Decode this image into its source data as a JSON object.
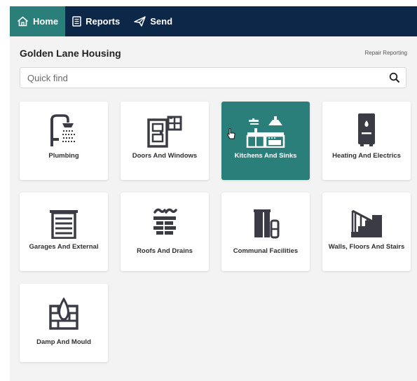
{
  "nav": {
    "home_label": "Home",
    "reports_label": "Reports",
    "send_label": "Send"
  },
  "header": {
    "title": "Golden Lane Housing",
    "subtitle": "Repair Reporting"
  },
  "search": {
    "placeholder": "Quick find",
    "value": ""
  },
  "tiles": [
    {
      "label": "Plumbing",
      "icon": "shower-icon"
    },
    {
      "label": "Doors And Windows",
      "icon": "door-window-icon"
    },
    {
      "label": "Kitchens And Sinks",
      "icon": "kitchen-icon",
      "selected": true
    },
    {
      "label": "Heating And Electrics",
      "icon": "boiler-icon"
    },
    {
      "label": "Garages And External",
      "icon": "garage-icon"
    },
    {
      "label": "Roofs And Drains",
      "icon": "roof-chimney-icon"
    },
    {
      "label": "Communal Facilities",
      "icon": "bins-icon"
    },
    {
      "label": "Walls, Floors And Stairs",
      "icon": "stairs-icon"
    },
    {
      "label": "Damp And Mould",
      "icon": "damp-wall-icon"
    }
  ],
  "colors": {
    "navbar": "#0d2748",
    "accent": "#2a7f7b",
    "icon": "#3b3b45"
  }
}
